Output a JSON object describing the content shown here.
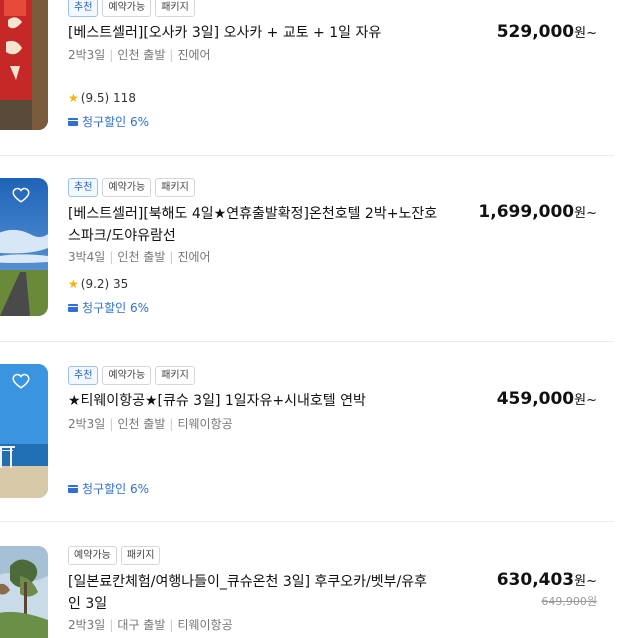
{
  "listings": [
    {
      "badges": [
        "추천",
        "예약가능",
        "패키지"
      ],
      "title": "[베스트셀러][오사카 3일] 오사카 + 교토 + 1일 자유",
      "duration": "2박3일",
      "departure": "인천 출발",
      "airline": "진에어",
      "rating": "(9.5)",
      "reviews": "118",
      "discount": "청구할인 6%",
      "price": "529,000",
      "price_suffix": "원~"
    },
    {
      "badges": [
        "추천",
        "예약가능",
        "패키지"
      ],
      "title": "[베스트셀러][북해도 4일★연휴출발확정]온천호텔 2박+노잔호스파크/도야유람선",
      "duration": "3박4일",
      "departure": "인천 출발",
      "airline": "진에어",
      "rating": "(9.2)",
      "reviews": "35",
      "discount": "청구할인 6%",
      "price": "1,699,000",
      "price_suffix": "원~"
    },
    {
      "badges": [
        "추천",
        "예약가능",
        "패키지"
      ],
      "title": "★티웨이항공★[큐슈 3일] 1일자유+시내호텔 연박",
      "duration": "2박3일",
      "departure": "인천 출발",
      "airline": "티웨이항공",
      "discount": "청구할인 6%",
      "price": "459,000",
      "price_suffix": "원~"
    },
    {
      "badges": [
        "예약가능",
        "패키지"
      ],
      "title": "[일본료칸체험/여행나들이_큐슈온천 3일] 후쿠오카/벳부/유후인 3일",
      "duration": "2박3일",
      "departure": "대구 출발",
      "airline": "티웨이항공",
      "price": "630,403",
      "price_suffix": "원~",
      "original_price": "649,900원"
    }
  ],
  "icons": {
    "wishlist": "heart-outline-icon",
    "rating": "star-icon",
    "discount": "credit-card-icon"
  },
  "colors": {
    "accent_blue": "#2f6fd6",
    "star": "#f5b400"
  }
}
